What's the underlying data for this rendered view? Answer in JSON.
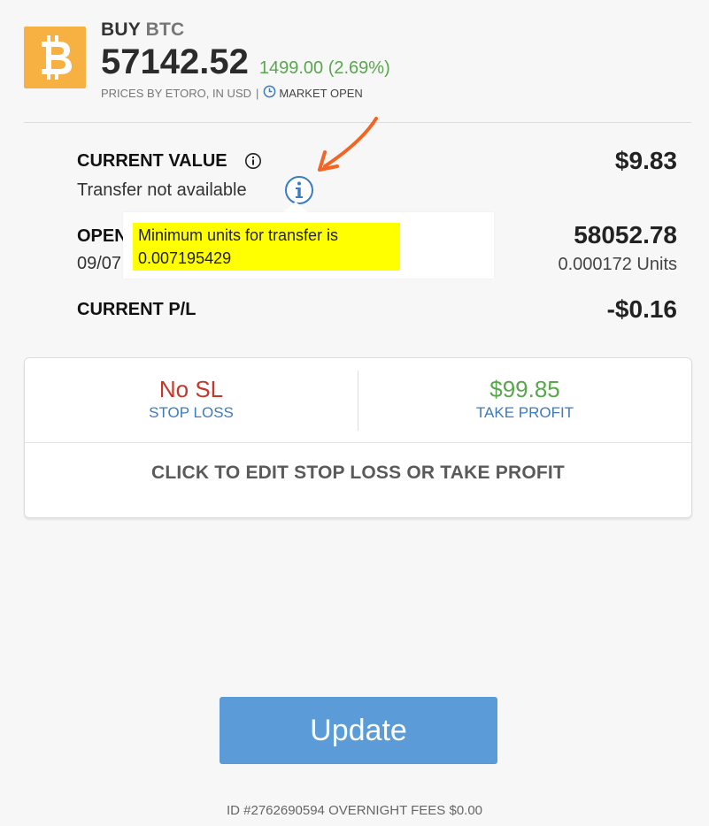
{
  "header": {
    "action": "BUY",
    "symbol": "BTC",
    "price": "57142.52",
    "change": "1499.00 (2.69%)",
    "price_source": "PRICES BY ETORO, IN USD",
    "separator": "|",
    "market_status": "MARKET OPEN",
    "logo_icon": "bitcoin-icon",
    "logo_color": "#f7b143"
  },
  "position": {
    "current_value_label": "CURRENT VALUE",
    "current_value": "$9.83",
    "transfer_status": "Transfer not available",
    "open_label": "OPEN",
    "open_date": "09/07",
    "open_price": "58052.78",
    "units": "0.000172 Units",
    "pl_label": "CURRENT P/L",
    "pl_value": "-$0.16"
  },
  "tooltip": {
    "text": "Minimum units for transfer is 0.007195429"
  },
  "sltp": {
    "stop_loss_value": "No SL",
    "stop_loss_label": "STOP LOSS",
    "take_profit_value": "$99.85",
    "take_profit_label": "TAKE PROFIT",
    "edit_label": "CLICK TO EDIT STOP LOSS OR TAKE PROFIT"
  },
  "actions": {
    "update_label": "Update"
  },
  "footer": {
    "text": "ID #2762690594 OVERNIGHT FEES $0.00"
  },
  "colors": {
    "accent_blue": "#5b9bd8",
    "positive_green": "#5aa64f",
    "negative_red": "#c0392b",
    "highlight_yellow": "#ffff00",
    "annotation_orange": "#f26522"
  }
}
